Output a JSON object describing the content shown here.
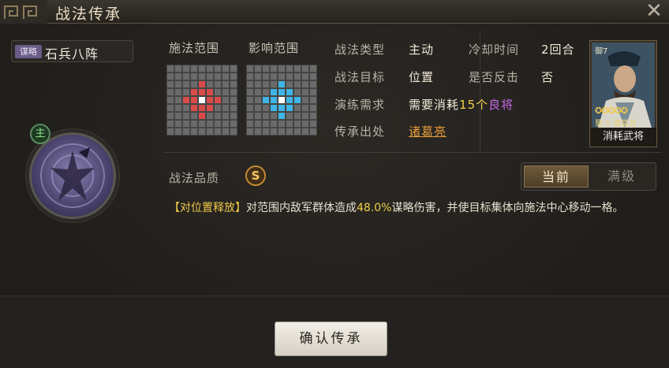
{
  "window": {
    "title": "战法传承",
    "close_icon": "✕"
  },
  "skill": {
    "category": "谋略",
    "name": "石兵八阵",
    "main_badge": "主"
  },
  "ranges": {
    "cast_label": "施法范围",
    "effect_label": "影响范围",
    "cast_color": "#d94b4b",
    "effect_color": "#3fb5e6"
  },
  "info": {
    "type_label": "战法类型",
    "type_value": "主动",
    "cooldown_label": "冷却时间",
    "cooldown_value": "2回合",
    "target_label": "战法目标",
    "target_value": "位置",
    "counter_label": "是否反击",
    "counter_value": "否",
    "drill_label": "演练需求",
    "drill_prefix": "需要消耗",
    "drill_count": "15个",
    "drill_grade": "良将",
    "origin_label": "传承出处",
    "origin_value": "诸葛亮"
  },
  "card": {
    "faction": "蜀",
    "stars": "✪✪✪✪✪",
    "level_text": "蜀 5 诸葛亮",
    "caption": "消耗武将",
    "side_text": "御7"
  },
  "quality": {
    "label": "战法品质",
    "grade": "S"
  },
  "toggle": {
    "current": "当前",
    "max": "满级"
  },
  "description": {
    "tag": "【对位置释放】",
    "part1": "对范围内敌军群体造成",
    "percent": "48.0%",
    "part2": "谋略伤害，并使目标集体向施法中心移动一格。"
  },
  "footer": {
    "confirm_label": "确认传承"
  }
}
